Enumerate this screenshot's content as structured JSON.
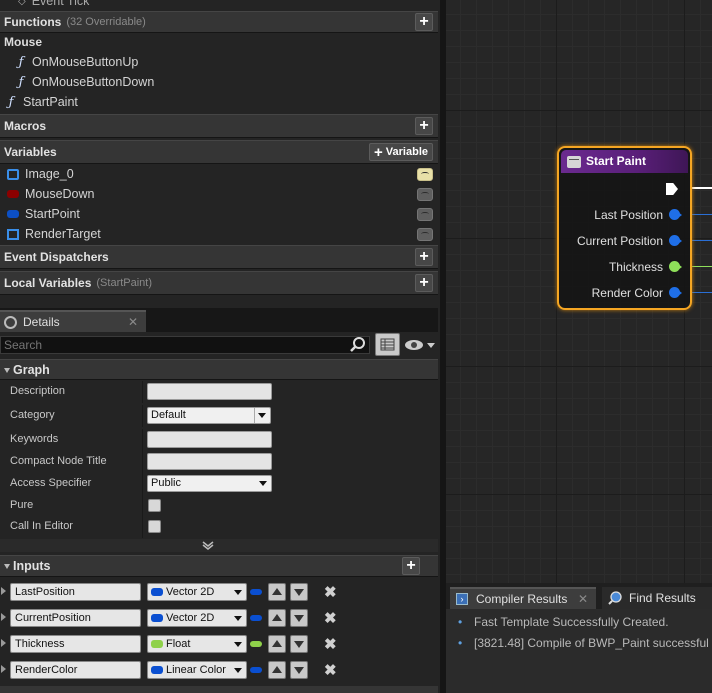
{
  "my_blueprint": {
    "event_tick_label": "Event Tick",
    "functions": {
      "title": "Functions",
      "override_count": "(32 Overridable)",
      "group": "Mouse",
      "items": [
        "OnMouseButtonUp",
        "OnMouseButtonDown",
        "StartPaint"
      ]
    },
    "macros": {
      "title": "Macros"
    },
    "variables": {
      "title": "Variables",
      "add_label": "Variable",
      "items": [
        {
          "name": "Image_0",
          "color": "#3a8ee8",
          "visible": true
        },
        {
          "name": "MouseDown",
          "color": "#8b0000",
          "visible": false
        },
        {
          "name": "StartPoint",
          "color": "#0c4fc4",
          "visible": false
        },
        {
          "name": "RenderTarget",
          "color": "#3a8ee8",
          "visible": false
        }
      ]
    },
    "event_dispatchers": {
      "title": "Event Dispatchers"
    },
    "local_variables": {
      "title": "Local Variables",
      "scope": "(StartPaint)"
    }
  },
  "details": {
    "tab_label": "Details",
    "search_placeholder": "Search",
    "graph_section": "Graph",
    "properties": {
      "description": {
        "label": "Description",
        "value": ""
      },
      "category": {
        "label": "Category",
        "value": "Default"
      },
      "keywords": {
        "label": "Keywords",
        "value": ""
      },
      "compact_node_title": {
        "label": "Compact Node Title",
        "value": ""
      },
      "access_specifier": {
        "label": "Access Specifier",
        "value": "Public"
      },
      "pure": {
        "label": "Pure",
        "checked": false
      },
      "call_in_editor": {
        "label": "Call In Editor",
        "checked": false
      }
    },
    "inputs_section": "Inputs",
    "inputs": [
      {
        "name": "LastPosition",
        "type": "Vector 2D",
        "color": "#0a4fd1"
      },
      {
        "name": "CurrentPosition",
        "type": "Vector 2D",
        "color": "#0a4fd1"
      },
      {
        "name": "Thickness",
        "type": "Float",
        "color": "#8fd14a"
      },
      {
        "name": "RenderColor",
        "type": "Linear Color",
        "color": "#0a4fd1"
      }
    ]
  },
  "graph": {
    "node": {
      "title": "Start Paint",
      "pins": [
        {
          "label": "Last Position",
          "color": "#1f6fe8"
        },
        {
          "label": "Current Position",
          "color": "#1f6fe8"
        },
        {
          "label": "Thickness",
          "color": "#8fe05a"
        },
        {
          "label": "Render Color",
          "color": "#1f6fe8"
        }
      ]
    }
  },
  "compiler": {
    "tabs": [
      "Compiler Results",
      "Find Results"
    ],
    "messages": [
      "Fast Template Successfully Created.",
      "[3821.48] Compile of BWP_Paint successful"
    ]
  }
}
